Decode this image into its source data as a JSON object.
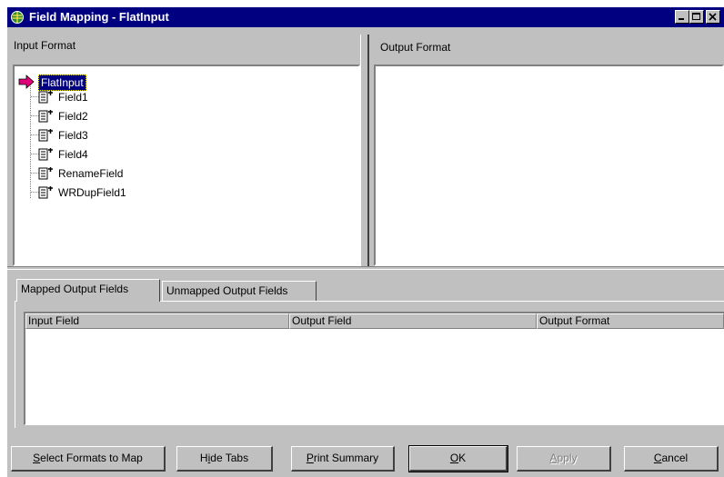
{
  "window": {
    "title": "Field Mapping - FlatInput",
    "controls": [
      "minimize-icon",
      "maximize-icon",
      "close-icon"
    ]
  },
  "input_format": {
    "label": "Input Format",
    "root": "FlatInput",
    "fields": [
      "Field1",
      "Field2",
      "Field3",
      "Field4",
      "RenameField",
      "WRDupField1"
    ]
  },
  "output_format": {
    "label": "Output Format"
  },
  "tabs": [
    {
      "label": "Mapped Output Fields",
      "active": true
    },
    {
      "label": "Unmapped Output Fields",
      "active": false
    }
  ],
  "mapped_table": {
    "columns": [
      "Input Field",
      "Output Field",
      "Output Format"
    ],
    "rows": []
  },
  "buttons": {
    "select_formats_pre": "",
    "select_formats_key": "S",
    "select_formats_post": "elect Formats to Map",
    "hide_tabs_pre": "H",
    "hide_tabs_key": "i",
    "hide_tabs_post": "de Tabs",
    "print_summary_pre": "",
    "print_summary_key": "P",
    "print_summary_post": "rint Summary",
    "ok_pre": "",
    "ok_key": "O",
    "ok_post": "K",
    "apply_pre": "",
    "apply_key": "A",
    "apply_post": "pply",
    "cancel_pre": "",
    "cancel_key": "C",
    "cancel_post": "ancel"
  },
  "colors": {
    "title_bar": "#000080",
    "face": "#c0c0c0",
    "selection": "#000080",
    "root_arrow": "#e0007a"
  }
}
